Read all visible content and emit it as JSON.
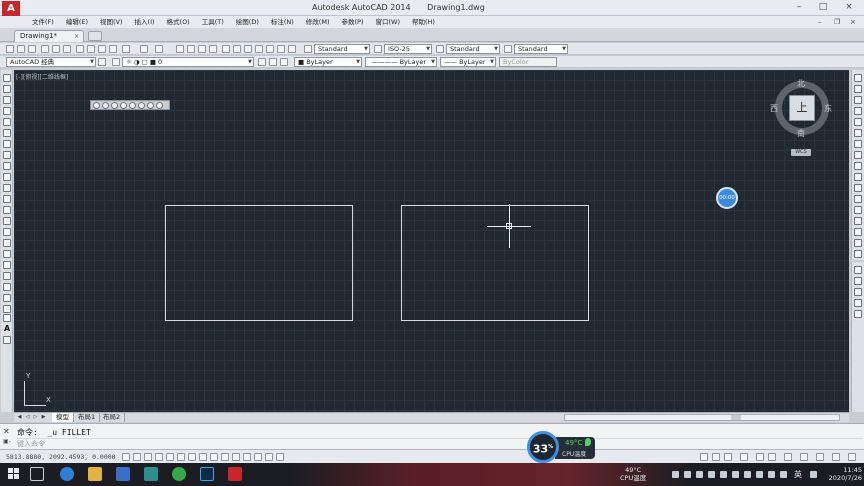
{
  "window": {
    "app_name": "Autodesk AutoCAD 2014",
    "file_name": "Drawing1.dwg",
    "logo_letter": "A"
  },
  "menu": {
    "items": [
      "文件(F)",
      "编辑(E)",
      "视图(V)",
      "插入(I)",
      "格式(O)",
      "工具(T)",
      "绘图(D)",
      "标注(N)",
      "修改(M)",
      "参数(P)",
      "窗口(W)",
      "帮助(H)"
    ]
  },
  "tabs": {
    "document": "Drawing1*",
    "close_glyph": "×"
  },
  "toolbar1": {
    "text_style": "Standard",
    "dim_style": "ISO-25",
    "table_style": "Standard",
    "multileader_style": "Standard"
  },
  "toolbar2": {
    "workspace": "AutoCAD 经典",
    "layer": "0",
    "color": "ByLayer",
    "linetype": "ByLayer",
    "lineweight": "ByLayer",
    "plot_style": "ByColor"
  },
  "viewport": {
    "label": "[-][俯视][二维线框]"
  },
  "viewcube": {
    "face": "上",
    "north": "北",
    "south": "南",
    "west": "西",
    "east": "东",
    "wcs": "WCS"
  },
  "timer_badge": "00:00",
  "ucs": {
    "x": "X",
    "y": "Y"
  },
  "layout_tabs": {
    "model": "模型",
    "layout1": "布局1",
    "layout2": "布局2"
  },
  "command": {
    "history": "命令:  _u FILLET",
    "prompt": "键入命令"
  },
  "status": {
    "coordinates": "5813.8880, 2092.4593, 0.0000"
  },
  "cpu": {
    "usage": "33",
    "unit": "%",
    "temp": "49°C",
    "label": "CPU温度"
  },
  "taskbar": {
    "tray_temp": "49°C",
    "tray_temp_label": "CPU温度",
    "ime": "英",
    "time": "11:45",
    "date": "2020/7/26"
  },
  "colors": {
    "canvas": "#212830",
    "accent": "#3a8be0",
    "autocad_red": "#c8262a"
  }
}
